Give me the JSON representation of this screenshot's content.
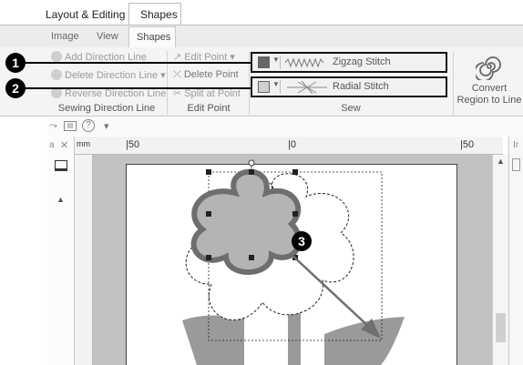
{
  "tabs_top": {
    "layout_editing": "Layout & Editing",
    "shapes": "Shapes"
  },
  "tabs_second": {
    "image": "Image",
    "view": "View",
    "shapes": "Shapes"
  },
  "ribbon": {
    "sewing_direction": {
      "add": "Add Direction Line",
      "delete": "Delete Direction Line ▾",
      "reverse": "Reverse Direction Line",
      "group_label": "Sewing Direction Line"
    },
    "edit_point": {
      "edit": "Edit Point ▾",
      "delete": "Delete Point",
      "split": "Split at Point",
      "group_label": "Edit Point"
    },
    "sew": {
      "zigzag": "Zigzag Stitch",
      "radial": "Radial Stitch",
      "group_label": "Sew"
    },
    "convert_line1": "Convert",
    "convert_line2": "Region to Line"
  },
  "quick_access": {
    "help": "?",
    "more": "▾"
  },
  "rulers": {
    "unit": "mm",
    "ticks": [
      "|50",
      "|0",
      "|50"
    ]
  },
  "callouts": [
    "1",
    "2",
    "3"
  ],
  "colors": {
    "shape_fill": "#b4b4b4",
    "shape_outline": "#6e6e6e",
    "arrow": "#6f6f6f"
  }
}
